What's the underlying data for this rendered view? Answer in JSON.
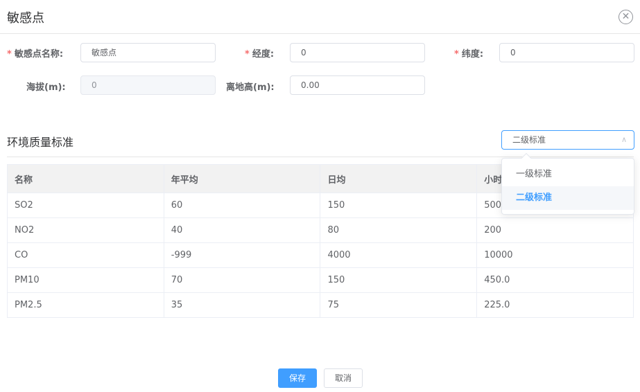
{
  "dialog": {
    "title": "敏感点",
    "close_icon": "close-circle-icon"
  },
  "form": {
    "name_label": "敏感点名称:",
    "name_value": "敏感点",
    "lng_label": "经度:",
    "lng_value": "0",
    "lat_label": "纬度:",
    "lat_value": "0",
    "altitude_label": "海拔(m):",
    "altitude_value": "0",
    "height_label": "离地高(m):",
    "height_value": "0.00",
    "required_mark": "*"
  },
  "standard": {
    "section_title": "环境质量标准",
    "selected": "二级标准",
    "options": [
      "一级标准",
      "二级标准"
    ]
  },
  "table": {
    "headers": [
      "名称",
      "年平均",
      "日均",
      "小时"
    ],
    "rows": [
      [
        "SO2",
        "60",
        "150",
        "500"
      ],
      [
        "NO2",
        "40",
        "80",
        "200"
      ],
      [
        "CO",
        "-999",
        "4000",
        "10000"
      ],
      [
        "PM10",
        "70",
        "150",
        "450.0"
      ],
      [
        "PM2.5",
        "35",
        "75",
        "225.0"
      ]
    ]
  },
  "footer": {
    "save_label": "保存",
    "cancel_label": "取消"
  },
  "colors": {
    "primary": "#409eff",
    "required": "#f56c6c"
  }
}
